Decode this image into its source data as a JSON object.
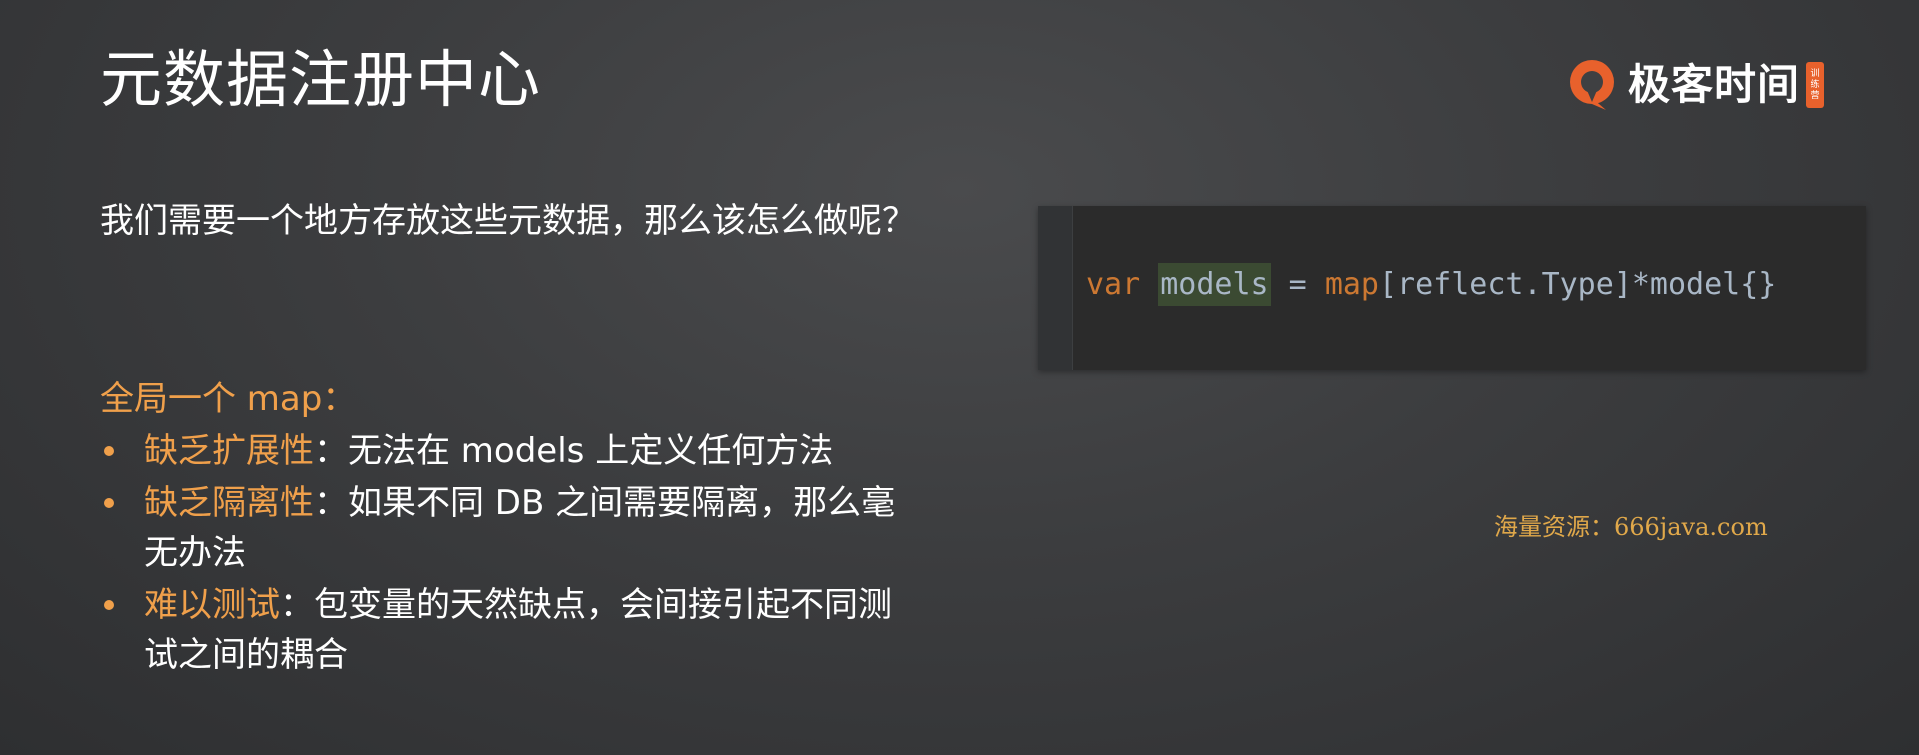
{
  "slide": {
    "title": "元数据注册中心"
  },
  "logo": {
    "text": "极客时间",
    "badge": [
      "训",
      "练",
      "营"
    ]
  },
  "intro": {
    "text": "我们需要一个地方存放这些元数据，那么该怎么做呢？"
  },
  "section": {
    "heading": "全局一个 map："
  },
  "bullets": [
    {
      "key": "缺乏扩展性",
      "text": "：无法在 models 上定义任何方法"
    },
    {
      "key": "缺乏隔离性",
      "text": "：如果不同 DB 之间需要隔离，那么毫无办法"
    },
    {
      "key": "难以测试",
      "text": "：包变量的天然缺点，会间接引起不同测试之间的耦合"
    }
  ],
  "code": {
    "tokens": {
      "t0": "var",
      "t1": " ",
      "t2": "models",
      "t3": " = ",
      "t4": "map",
      "t5": "[reflect.",
      "t6": "Type",
      "t7": "]*model{}"
    }
  },
  "watermark": {
    "text": "海量资源：666java.com"
  },
  "colors": {
    "accent": "#f0a04b",
    "keyword": "#cc7832",
    "code_text": "#a9b7c6",
    "code_bg": "#2b2b2b",
    "logo_orange": "#e8612c"
  }
}
